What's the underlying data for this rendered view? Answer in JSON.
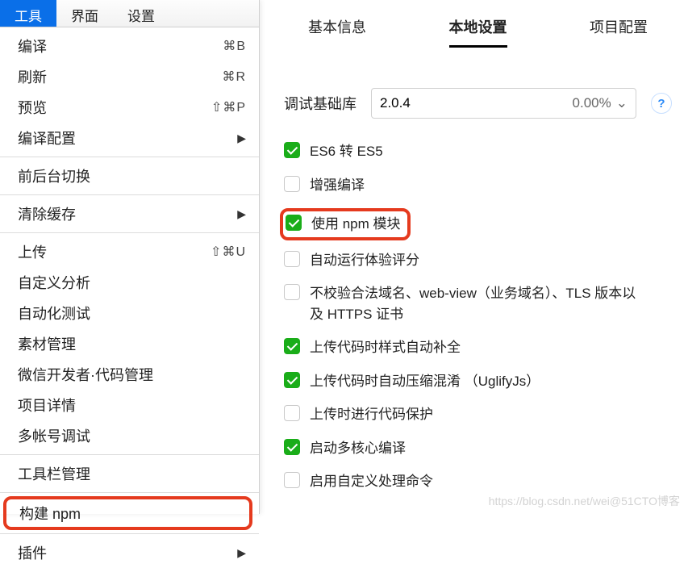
{
  "menubar": {
    "tools": "工具",
    "ui": "界面",
    "settings": "设置"
  },
  "menu": {
    "compile": {
      "label": "编译",
      "shortcut": "⌘B"
    },
    "refresh": {
      "label": "刷新",
      "shortcut": "⌘R"
    },
    "preview": {
      "label": "预览",
      "shortcut": "⇧⌘P"
    },
    "compile_config": {
      "label": "编译配置"
    },
    "fg_bg_switch": {
      "label": "前后台切换"
    },
    "clear_cache": {
      "label": "清除缓存"
    },
    "upload": {
      "label": "上传",
      "shortcut": "⇧⌘U"
    },
    "custom_analyze": {
      "label": "自定义分析"
    },
    "auto_test": {
      "label": "自动化测试"
    },
    "material_mgmt": {
      "label": "素材管理"
    },
    "wechat_dev": {
      "label": "微信开发者·代码管理"
    },
    "project_detail": {
      "label": "项目详情"
    },
    "multi_account": {
      "label": "多帐号调试"
    },
    "toolbar_mgmt": {
      "label": "工具栏管理"
    },
    "build_npm": {
      "label": "构建 npm"
    },
    "plugins": {
      "label": "插件"
    }
  },
  "tabs": {
    "basic": "基本信息",
    "local": "本地设置",
    "project": "项目配置"
  },
  "lib": {
    "label": "调试基础库",
    "version": "2.0.4",
    "percent": "0.00%",
    "help": "?"
  },
  "checks": {
    "es6": "ES6 转 ES5",
    "enhance": "增强编译",
    "npm": "使用 npm 模块",
    "autoscore": "自动运行体验评分",
    "noverify": "不校验合法域名、web-view（业务域名）、TLS 版本以及 HTTPS 证书",
    "autostyle": "上传代码时样式自动补全",
    "uglify": "上传代码时自动压缩混淆 （UglifyJs）",
    "protect": "上传时进行代码保护",
    "multicore": "启动多核心编译",
    "customcmd": "启用自定义处理命令"
  },
  "watermark": "https://blog.csdn.net/wei@51CTO博客"
}
